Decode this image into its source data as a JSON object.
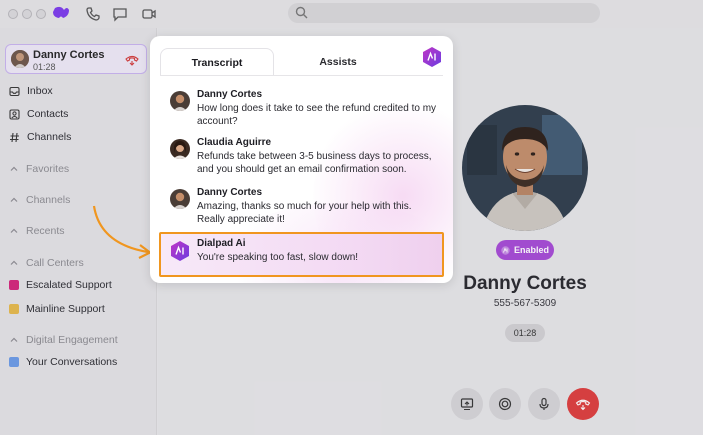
{
  "titlebar": {
    "search": {
      "placeholder": ""
    },
    "icons": [
      "dialpad-logo-icon",
      "phone-icon",
      "chat-icon",
      "video-icon",
      "search-icon"
    ]
  },
  "sidebar": {
    "active_call": {
      "name": "Danny Cortes",
      "time": "01:28"
    },
    "nav": [
      {
        "label": "Inbox",
        "icon": "inbox-icon"
      },
      {
        "label": "Contacts",
        "icon": "contacts-icon"
      },
      {
        "label": "Channels",
        "icon": "hash-icon"
      }
    ],
    "sections": {
      "favorites": "Favorites",
      "channels": "Channels",
      "recents": "Recents",
      "call_centers": "Call Centers",
      "digital_engagement": "Digital Engagement"
    },
    "call_centers": [
      {
        "label": "Escalated Support",
        "color": "#d4237a"
      },
      {
        "label": "Mainline Support",
        "color": "#e7b94a"
      }
    ],
    "digital": [
      {
        "label": "Your Conversations",
        "color": "#6b9be8"
      }
    ]
  },
  "transcript": {
    "tabs": {
      "active": "Transcript",
      "inactive": "Assists"
    },
    "messages": [
      {
        "speaker": "Danny Cortes",
        "text": "How long does it take to see the refund credited to my account?"
      },
      {
        "speaker": "Claudia Aguirre",
        "text": "Refunds take between 3-5 business days to process, and you should get an email confirmation soon."
      },
      {
        "speaker": "Danny Cortes",
        "text": "Amazing, thanks so much for your help with this. Really appreciate it!"
      }
    ],
    "ai_assist": {
      "speaker": "Dialpad Ai",
      "text": "You're speaking too fast, slow down!"
    }
  },
  "call": {
    "status": "Enabled",
    "name": "Danny Cortes",
    "phone": "555-567-5309",
    "timer": "01:28"
  },
  "colors": {
    "brand": "#7c3aed",
    "ai_gradient_start": "#c036c5",
    "ai_gradient_end": "#6c3ce0",
    "highlight": "#f0961f",
    "end_call": "#de3b3b"
  }
}
